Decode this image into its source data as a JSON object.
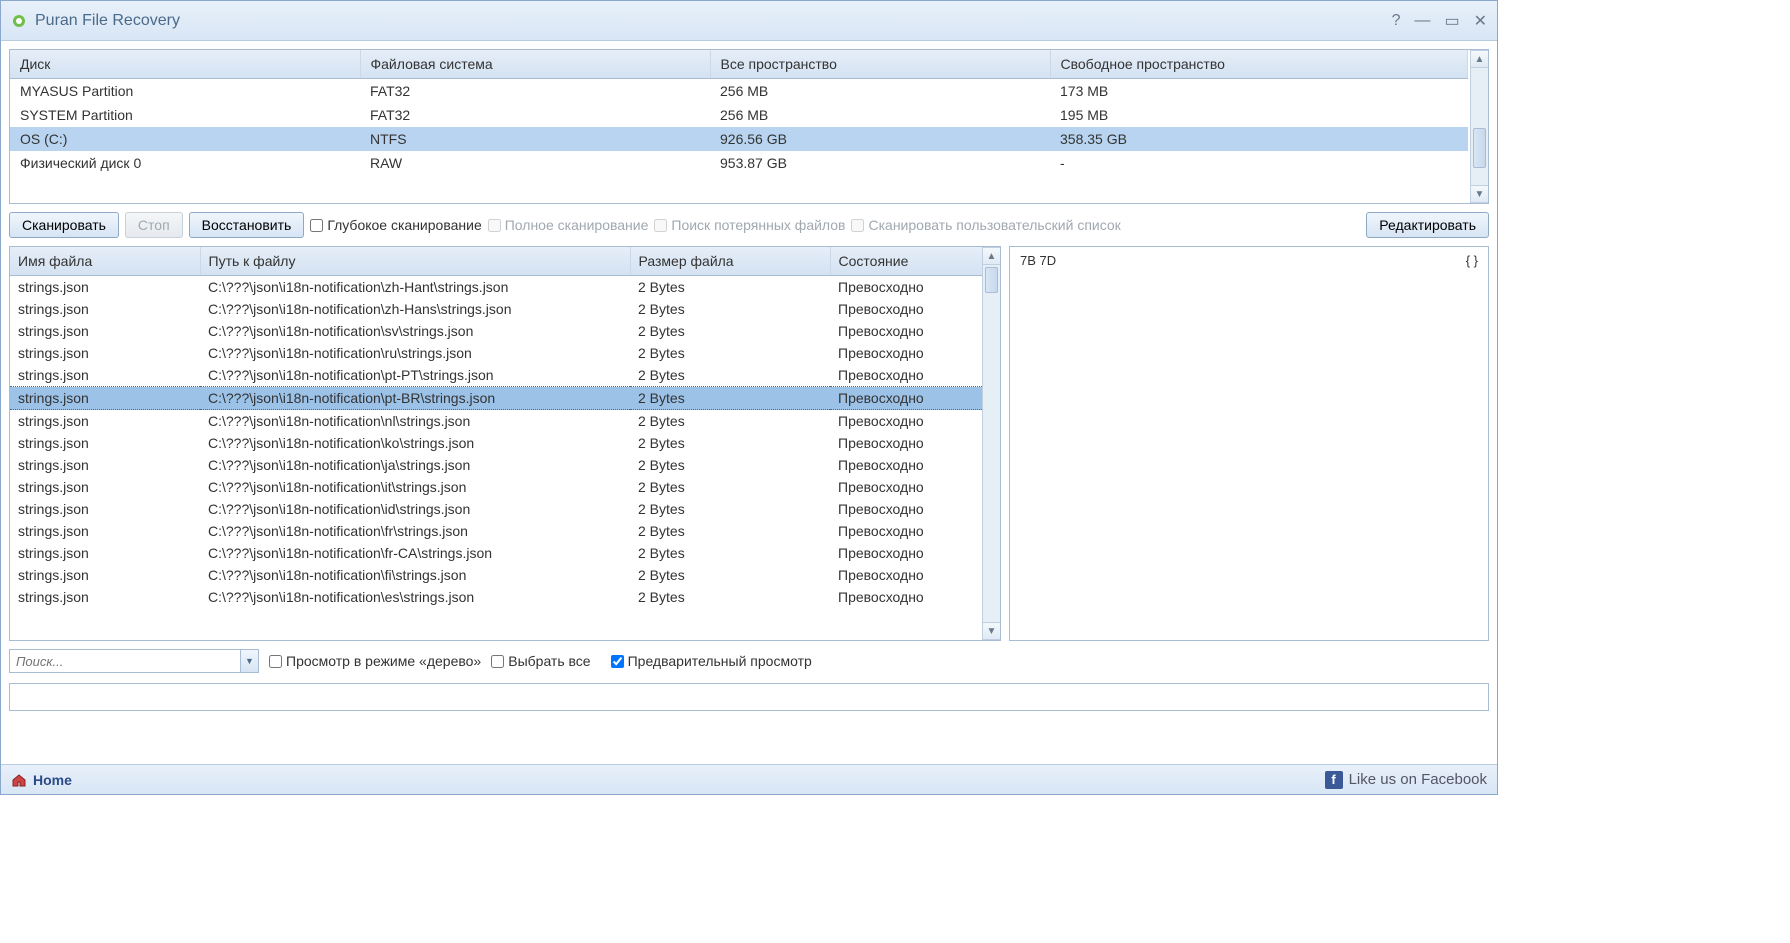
{
  "window": {
    "title": "Puran File Recovery"
  },
  "disk_table": {
    "headers": [
      "Диск",
      "Файловая система",
      "Все пространство",
      "Свободное пространство"
    ],
    "rows": [
      {
        "name": "MYASUS Partition",
        "fs": "FAT32",
        "total": "256 MB",
        "free": "173 MB",
        "selected": false
      },
      {
        "name": "SYSTEM Partition",
        "fs": "FAT32",
        "total": "256 MB",
        "free": "195 MB",
        "selected": false
      },
      {
        "name": "OS (C:)",
        "fs": "NTFS",
        "total": "926.56 GB",
        "free": "358.35 GB",
        "selected": true
      },
      {
        "name": "Физический диск 0",
        "fs": "RAW",
        "total": "953.87 GB",
        "free": "-",
        "selected": false
      }
    ]
  },
  "toolbar": {
    "scan": "Сканировать",
    "stop": "Стоп",
    "recover": "Восстановить",
    "deep_scan": "Глубокое сканирование",
    "full_scan": "Полное сканирование",
    "find_lost": "Поиск потерянных файлов",
    "scan_custom": "Сканировать пользовательский список",
    "edit": "Редактировать"
  },
  "files_table": {
    "headers": [
      "Имя файла",
      "Путь к файлу",
      "Размер файла",
      "Состояние"
    ],
    "rows": [
      {
        "name": "strings.json",
        "path": "C:\\???\\json\\i18n-notification\\zh-Hant\\strings.json",
        "size": "2 Bytes",
        "state": "Превосходно"
      },
      {
        "name": "strings.json",
        "path": "C:\\???\\json\\i18n-notification\\zh-Hans\\strings.json",
        "size": "2 Bytes",
        "state": "Превосходно"
      },
      {
        "name": "strings.json",
        "path": "C:\\???\\json\\i18n-notification\\sv\\strings.json",
        "size": "2 Bytes",
        "state": "Превосходно"
      },
      {
        "name": "strings.json",
        "path": "C:\\???\\json\\i18n-notification\\ru\\strings.json",
        "size": "2 Bytes",
        "state": "Превосходно"
      },
      {
        "name": "strings.json",
        "path": "C:\\???\\json\\i18n-notification\\pt-PT\\strings.json",
        "size": "2 Bytes",
        "state": "Превосходно"
      },
      {
        "name": "strings.json",
        "path": "C:\\???\\json\\i18n-notification\\pt-BR\\strings.json",
        "size": "2 Bytes",
        "state": "Превосходно",
        "selected": true
      },
      {
        "name": "strings.json",
        "path": "C:\\???\\json\\i18n-notification\\nl\\strings.json",
        "size": "2 Bytes",
        "state": "Превосходно"
      },
      {
        "name": "strings.json",
        "path": "C:\\???\\json\\i18n-notification\\ko\\strings.json",
        "size": "2 Bytes",
        "state": "Превосходно"
      },
      {
        "name": "strings.json",
        "path": "C:\\???\\json\\i18n-notification\\ja\\strings.json",
        "size": "2 Bytes",
        "state": "Превосходно"
      },
      {
        "name": "strings.json",
        "path": "C:\\???\\json\\i18n-notification\\it\\strings.json",
        "size": "2 Bytes",
        "state": "Превосходно"
      },
      {
        "name": "strings.json",
        "path": "C:\\???\\json\\i18n-notification\\id\\strings.json",
        "size": "2 Bytes",
        "state": "Превосходно"
      },
      {
        "name": "strings.json",
        "path": "C:\\???\\json\\i18n-notification\\fr\\strings.json",
        "size": "2 Bytes",
        "state": "Превосходно"
      },
      {
        "name": "strings.json",
        "path": "C:\\???\\json\\i18n-notification\\fr-CA\\strings.json",
        "size": "2 Bytes",
        "state": "Превосходно"
      },
      {
        "name": "strings.json",
        "path": "C:\\???\\json\\i18n-notification\\fi\\strings.json",
        "size": "2 Bytes",
        "state": "Превосходно"
      },
      {
        "name": "strings.json",
        "path": "C:\\???\\json\\i18n-notification\\es\\strings.json",
        "size": "2 Bytes",
        "state": "Превосходно"
      }
    ]
  },
  "preview": {
    "hex": "7B  7D",
    "ascii": "{ }"
  },
  "bottom": {
    "search_placeholder": "Поиск...",
    "tree_view": "Просмотр в режиме «дерево»",
    "select_all": "Выбрать все",
    "preview_label": "Предварительный просмотр"
  },
  "footer": {
    "home": "Home",
    "fb": "Like us on Facebook"
  }
}
